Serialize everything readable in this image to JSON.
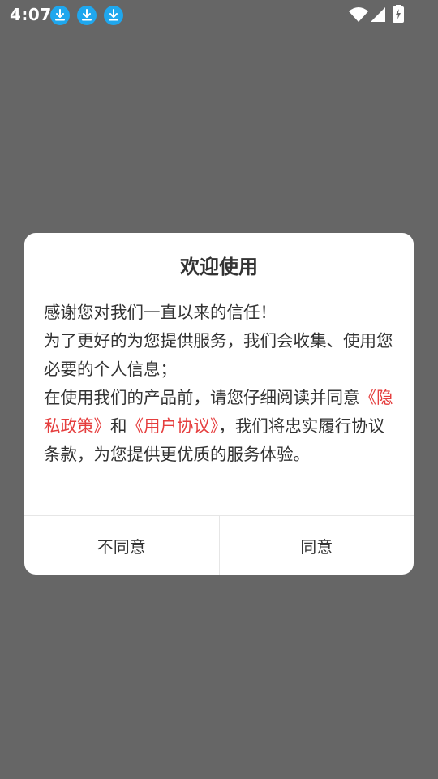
{
  "status_bar": {
    "time": "4:07",
    "notification_icons": [
      "download-icon",
      "download-icon",
      "download-icon"
    ],
    "status_icons": [
      "wifi-icon",
      "cell-signal-icon",
      "battery-charging-icon"
    ]
  },
  "dialog": {
    "title": "欢迎使用",
    "body": {
      "line1": "感谢您对我们一直以来的信任！",
      "line2": "为了更好的为您提供服务，我们会收集、使用您必要的个人信息；",
      "line3_prefix": "在使用我们的产品前，请您仔细阅读并同意",
      "privacy_link": "《隐私政策》",
      "and_text": "和",
      "agreement_link": "《用户协议》",
      "line3_suffix": "，我们将忠实履行协议条款，为您提供更优质的服务体验。"
    },
    "buttons": {
      "disagree": "不同意",
      "agree": "同意"
    }
  },
  "colors": {
    "overlay": "#666666",
    "link": "#e53e3e",
    "download_icon_bg": "#1fa7ee",
    "text": "#333333"
  }
}
